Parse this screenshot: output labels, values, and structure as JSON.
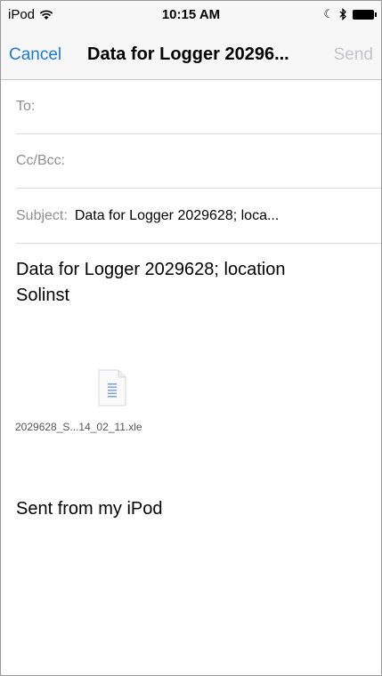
{
  "status_bar": {
    "carrier": "iPod",
    "time": "10:15 AM"
  },
  "nav": {
    "cancel_label": "Cancel",
    "title": "Data for Logger 20296...",
    "send_label": "Send"
  },
  "fields": {
    "to_label": "To:",
    "cc_label": "Cc/Bcc:",
    "subject_label": "Subject:",
    "subject_value": "Data for Logger 2029628; loca..."
  },
  "body": {
    "line1": "Data for Logger 2029628; location",
    "line2": "Solinst",
    "attachment_name": "2029628_S...14_02_11.xle",
    "signature": "Sent from my iPod"
  },
  "colors": {
    "accent": "#1a7ad9",
    "disabled": "#c4c4c8",
    "label": "#8e8e93"
  }
}
